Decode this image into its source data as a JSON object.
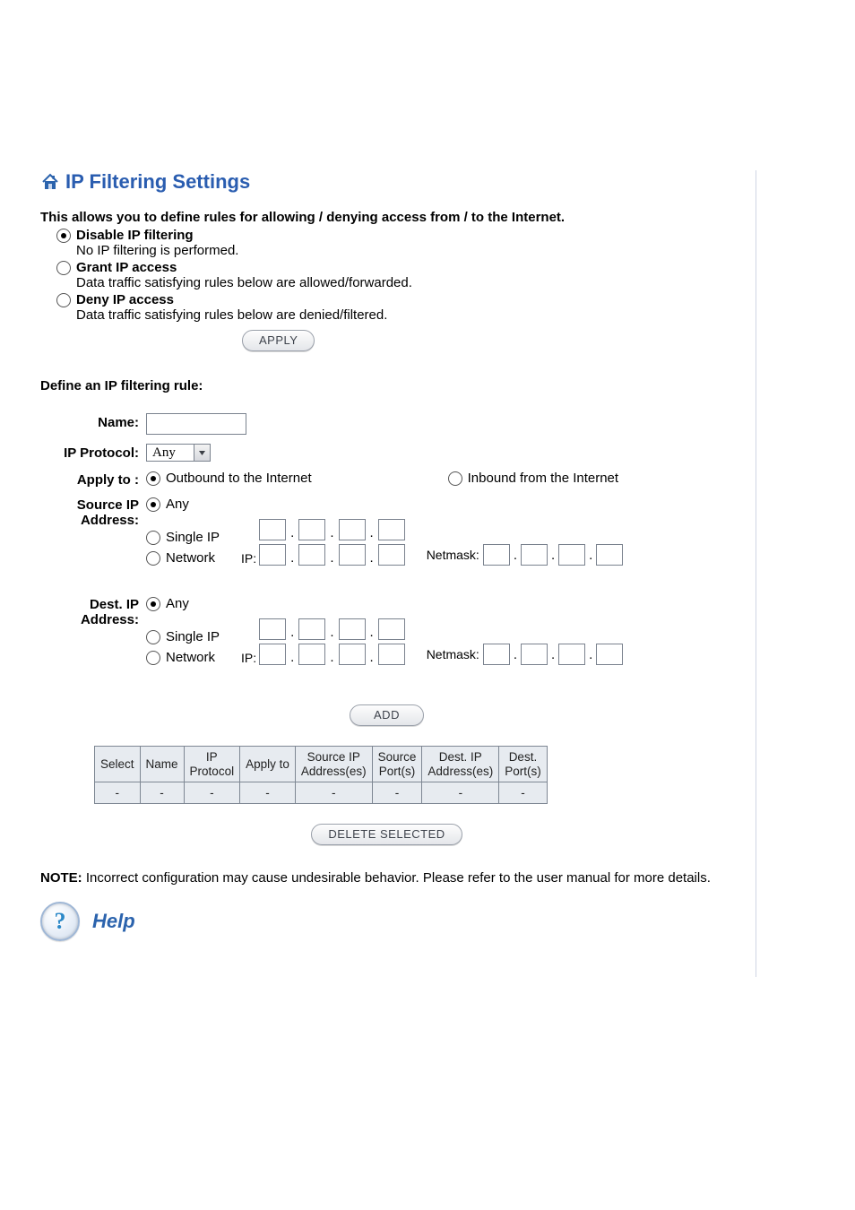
{
  "title": "IP Filtering Settings",
  "intro": "This allows you to define rules for allowing / denying access from / to the Internet.",
  "mode": {
    "options": [
      {
        "label": "Disable IP filtering",
        "desc": "No IP filtering is performed.",
        "selected": true
      },
      {
        "label": "Grant IP access",
        "desc": "Data traffic satisfying rules below are allowed/forwarded.",
        "selected": false
      },
      {
        "label": "Deny IP access",
        "desc": "Data traffic satisfying rules below are denied/filtered.",
        "selected": false
      }
    ]
  },
  "buttons": {
    "apply": "APPLY",
    "add": "ADD",
    "delete": "DELETE SELECTED"
  },
  "define_heading": "Define an IP filtering rule:",
  "form": {
    "name_label": "Name:",
    "protocol_label": "IP Protocol:",
    "protocol_value": "Any",
    "applyto_label": "Apply to :",
    "applyto_options": [
      "Outbound to the Internet",
      "Inbound from the Internet"
    ],
    "applyto_selected": 0,
    "source": {
      "line1": "Source IP",
      "line2": "Address:",
      "selected": "any"
    },
    "dest": {
      "line1": "Dest. IP",
      "line2": "Address:",
      "selected": "any"
    },
    "ip_opts": {
      "any": "Any",
      "single": "Single IP",
      "network": "Network"
    },
    "ip_lbl": "IP:",
    "netmask_lbl": "Netmask:"
  },
  "table": {
    "headers": {
      "0": "Select",
      "1": "Name",
      "2a": "IP",
      "2b": "Protocol",
      "3": "Apply to",
      "4a": "Source IP",
      "4b": "Address(es)",
      "5a": "Source",
      "5b": "Port(s)",
      "6a": "Dest. IP",
      "6b": "Address(es)",
      "7a": "Dest.",
      "7b": "Port(s)"
    },
    "rows": [
      [
        "-",
        "-",
        "-",
        "-",
        "-",
        "-",
        "-",
        "-"
      ]
    ]
  },
  "note": {
    "prefix": "NOTE:",
    "text": "Incorrect configuration may cause undesirable behavior. Please refer to the user manual for more details."
  },
  "help_label": "Help"
}
